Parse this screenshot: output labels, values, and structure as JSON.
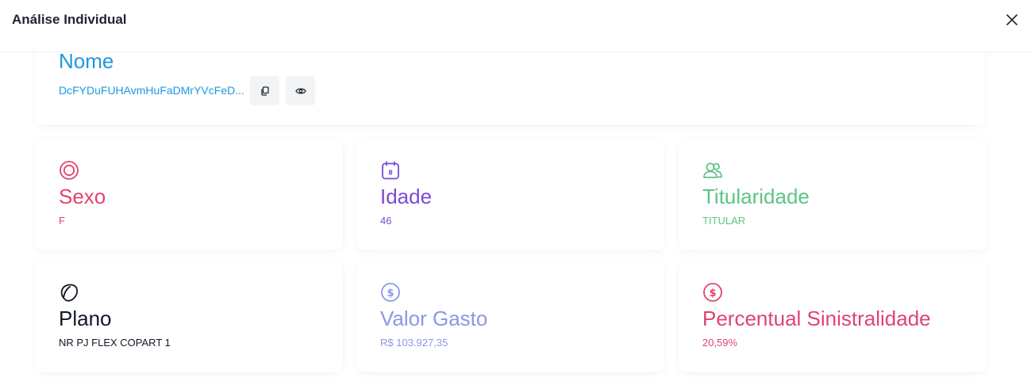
{
  "modal": {
    "title": "Análise Individual"
  },
  "name_card": {
    "label": "Nome",
    "value": "DcFYDuFUHAvmHuFaDMrYVcFeD..."
  },
  "colors": {
    "pink": "#e0446e",
    "purple": "#7b49d8",
    "green": "#5cc582",
    "black": "#111827",
    "periwinkle": "#8c97e6",
    "blue": "#1e98dd"
  },
  "stats": [
    {
      "label": "Sexo",
      "value": "F",
      "icon": "target-icon",
      "color": "#e0446e"
    },
    {
      "label": "Idade",
      "value": "46",
      "icon": "calendar-icon",
      "color": "#7b49d8"
    },
    {
      "label": "Titularidade",
      "value": "TITULAR",
      "icon": "users-icon",
      "color": "#5cc582"
    },
    {
      "label": "Plano",
      "value": "NR PJ FLEX COPART 1",
      "icon": "shape-icon",
      "color": "#111827"
    },
    {
      "label": "Valor Gasto",
      "value": "R$ 103.927,35",
      "icon": "dollar-circle-icon",
      "color": "#8c97e6"
    },
    {
      "label": "Percentual Sinistralidade",
      "value": "20,59%",
      "icon": "dollar-circle-icon",
      "color": "#e0446e"
    }
  ]
}
